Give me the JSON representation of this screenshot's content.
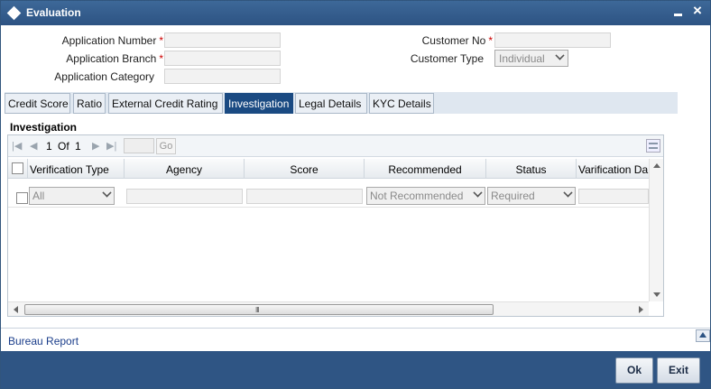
{
  "window": {
    "title": "Evaluation",
    "minimize": "minimize",
    "close": "×"
  },
  "form": {
    "application_number": {
      "label": "Application Number",
      "required": "*",
      "value": ""
    },
    "application_branch": {
      "label": "Application Branch",
      "required": "*",
      "value": ""
    },
    "application_category": {
      "label": "Application Category",
      "value": ""
    },
    "customer_no": {
      "label": "Customer No",
      "required": "*",
      "value": ""
    },
    "customer_type": {
      "label": "Customer Type",
      "value": "Individual"
    }
  },
  "tabs": [
    {
      "label": "Credit Score"
    },
    {
      "label": "Ratio"
    },
    {
      "label": "External Credit Rating"
    },
    {
      "label": "Investigation",
      "active": true
    },
    {
      "label": "Legal Details"
    },
    {
      "label": "KYC Details"
    }
  ],
  "investigation": {
    "title": "Investigation",
    "pager": {
      "current": "1",
      "of_label": "Of",
      "total": "1",
      "go_label": "Go"
    },
    "columns": [
      "Verification Type",
      "Agency",
      "Score",
      "Recommended",
      "Status",
      "Varification Da"
    ],
    "rows": [
      {
        "verification_type": "All",
        "agency": "",
        "score": "",
        "recommended": "Not Recommended",
        "status": "Required",
        "verification_date": ""
      }
    ],
    "scroll_grip": "III"
  },
  "footer": {
    "bureau_report": "Bureau Report"
  },
  "buttons": {
    "ok": "Ok",
    "exit": "Exit"
  },
  "colors": {
    "titlebar": "#2d5383",
    "active_tab": "#1a4a82",
    "bottom_bar": "#2f5584",
    "required": "#cc0000"
  }
}
